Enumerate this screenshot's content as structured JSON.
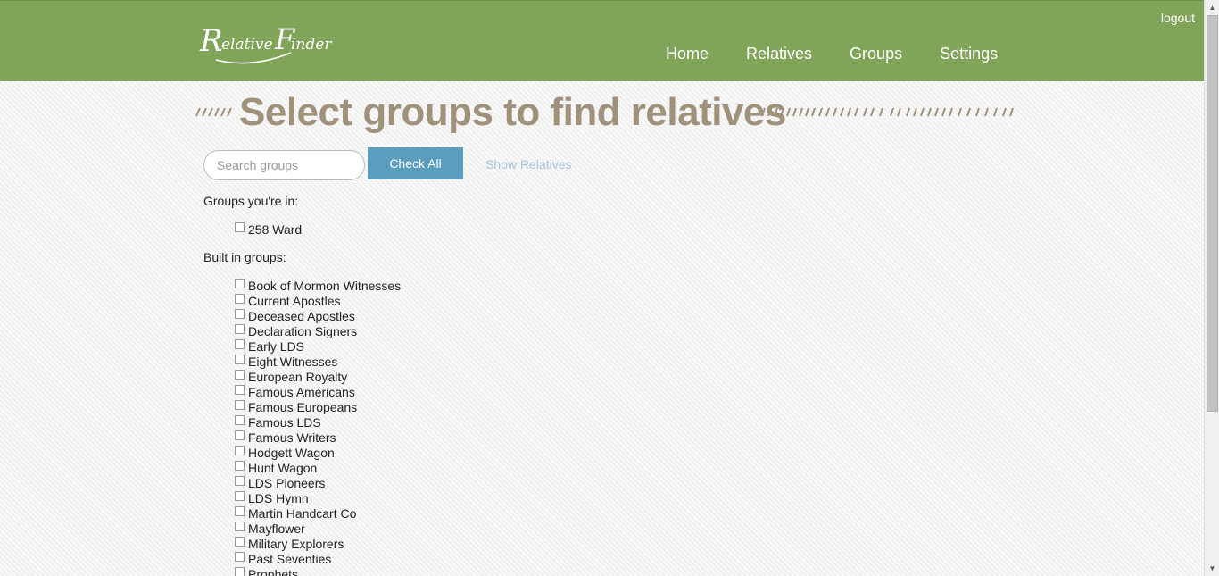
{
  "header": {
    "logo_text": "Relative Finder",
    "logout": "logout",
    "nav": [
      "Home",
      "Relatives",
      "Groups",
      "Settings"
    ]
  },
  "page": {
    "title": "Select groups to find relatives",
    "search_placeholder": "Search groups",
    "check_all": "Check All",
    "show_relatives": "Show Relatives"
  },
  "sections": {
    "my_groups_label": "Groups you're in:",
    "my_groups": [
      "258 Ward"
    ],
    "built_in_label": "Built in groups:",
    "built_in": [
      "Book of Mormon Witnesses",
      "Current Apostles",
      "Deceased Apostles",
      "Declaration Signers",
      "Early LDS",
      "Eight Witnesses",
      "European Royalty",
      "Famous Americans",
      "Famous Europeans",
      "Famous LDS",
      "Famous Writers",
      "Hodgett Wagon",
      "Hunt Wagon",
      "LDS Pioneers",
      "LDS Hymn",
      "Martin Handcart Co",
      "Mayflower",
      "Military Explorers",
      "Past Seventies",
      "Prophets"
    ]
  },
  "colors": {
    "header_bg": "#80a558",
    "title": "#a0917b",
    "button": "#5b9dbd"
  }
}
